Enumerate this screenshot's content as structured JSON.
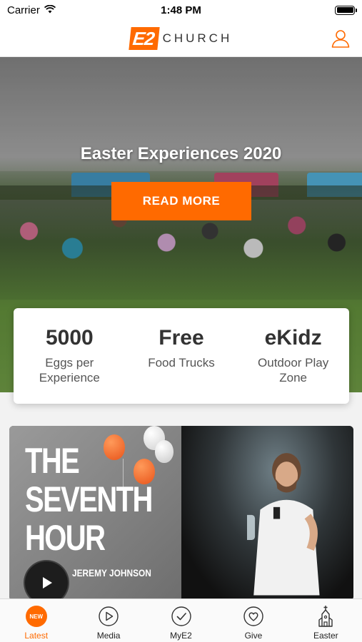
{
  "status_bar": {
    "carrier": "Carrier",
    "time": "1:48 PM"
  },
  "header": {
    "logo_mark": "E2",
    "logo_text": "CHURCH"
  },
  "hero": {
    "title": "Easter Experiences 2020",
    "button_label": "READ MORE"
  },
  "stats": [
    {
      "value": "5000",
      "label_line1": "Eggs per",
      "label_line2": "Experience"
    },
    {
      "value": "Free",
      "label_line1": "Food Trucks",
      "label_line2": ""
    },
    {
      "value": "eKidz",
      "label_line1": "Outdoor Play",
      "label_line2": "Zone"
    }
  ],
  "media_card": {
    "series_line1": "THE",
    "series_line2": "SEVENTH",
    "series_line3": "HOUR",
    "speaker": "JEREMY JOHNSON"
  },
  "tab_bar": {
    "tabs": [
      {
        "label": "Latest",
        "icon": "new-badge-icon",
        "badge": "NEW",
        "active": true
      },
      {
        "label": "Media",
        "icon": "play-circle-icon",
        "active": false
      },
      {
        "label": "MyE2",
        "icon": "check-circle-icon",
        "active": false
      },
      {
        "label": "Give",
        "icon": "heart-circle-icon",
        "active": false
      },
      {
        "label": "Easter",
        "icon": "chapel-icon",
        "active": false
      }
    ]
  },
  "colors": {
    "accent": "#ff6a00",
    "card_background": "#ffffff",
    "tab_active": "#ff6a00"
  }
}
